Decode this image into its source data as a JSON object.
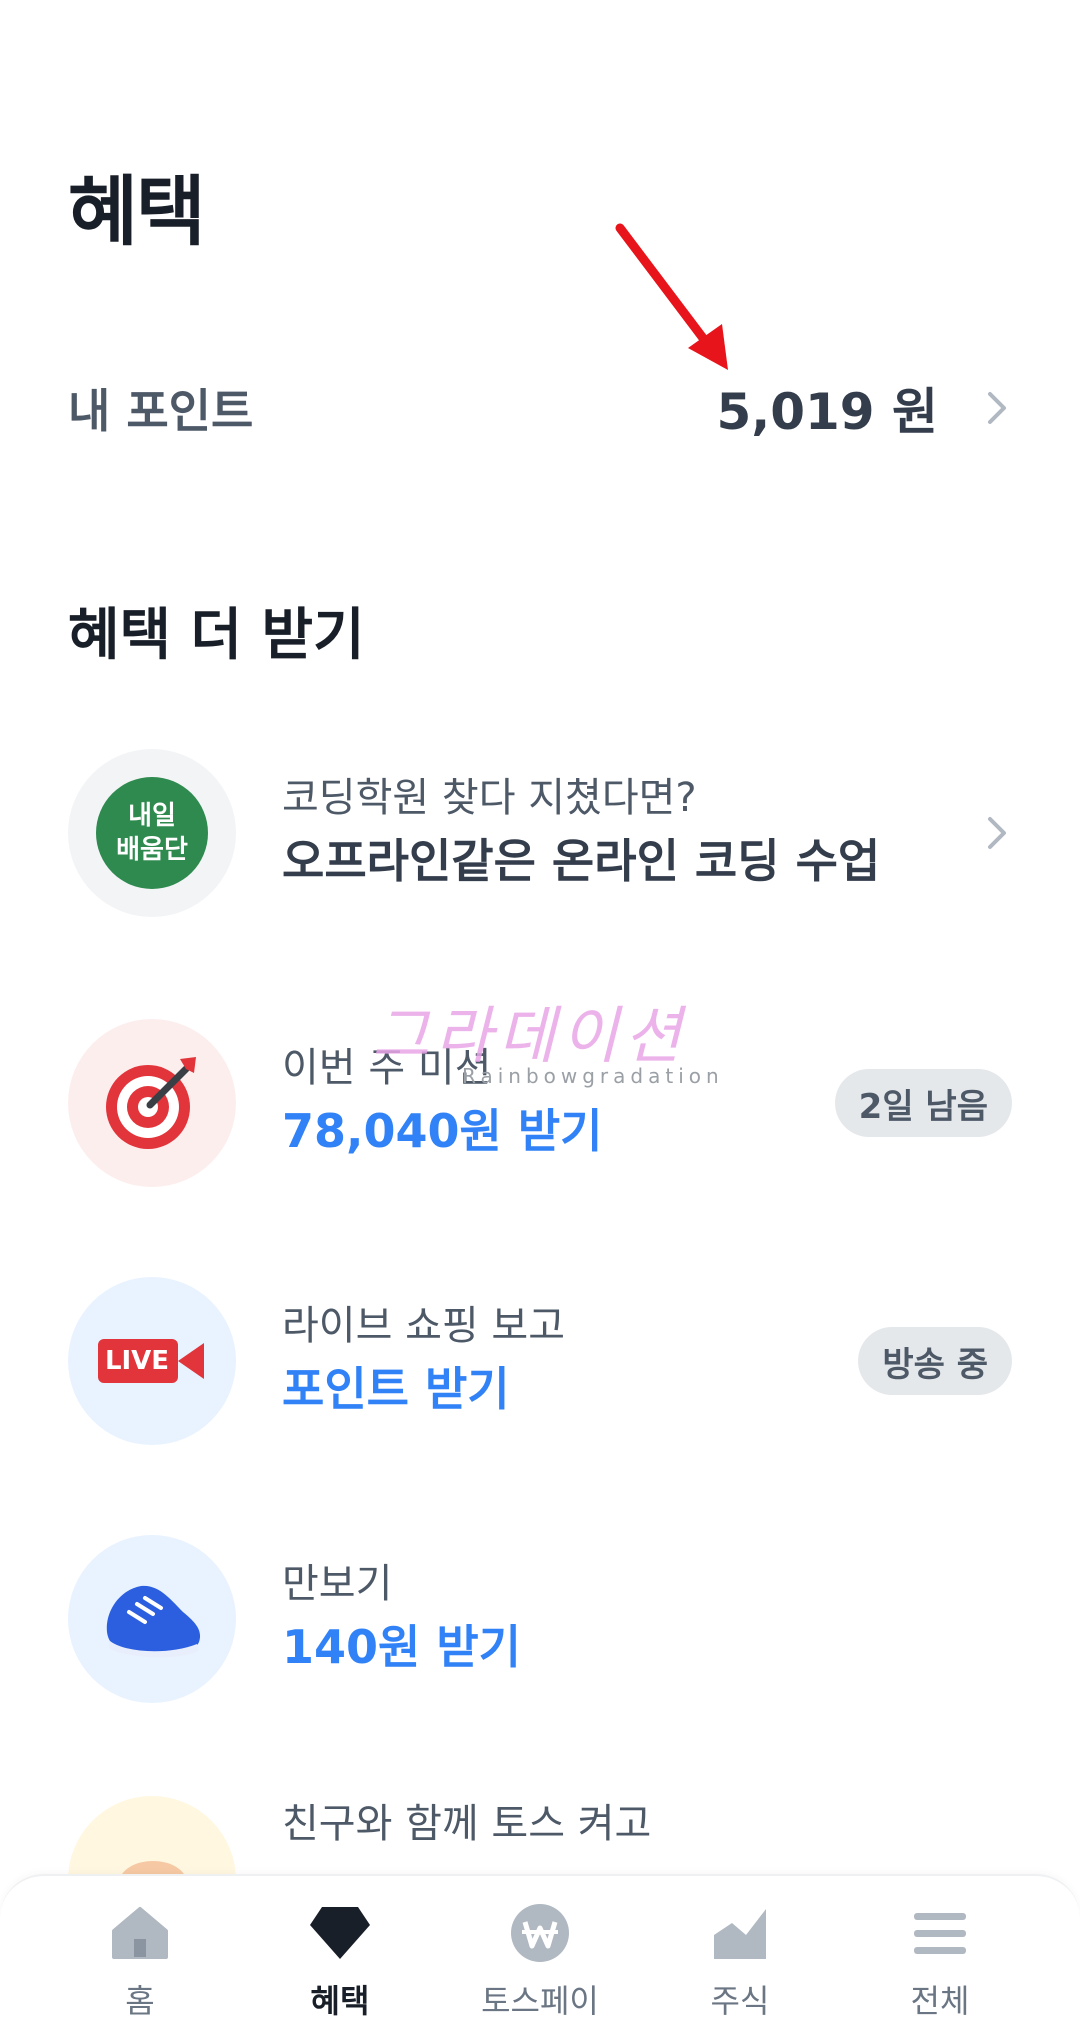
{
  "header": {
    "title": "혜택"
  },
  "points": {
    "label": "내 포인트",
    "value": "5,019 원"
  },
  "section": {
    "title": "혜택 더 받기"
  },
  "items": [
    {
      "sub": "코딩학원 찾다 지쳤다면?",
      "main": "오프라인같은 온라인 코딩 수업",
      "logo_line1": "내일",
      "logo_line2": "배움단"
    },
    {
      "sub": "이번 주 미션",
      "main": "78,040원 받기",
      "badge": "2일 남음"
    },
    {
      "sub": "라이브 쇼핑 보고",
      "main": "포인트 받기",
      "badge": "방송 중",
      "icon_text": "LIVE"
    },
    {
      "sub": "만보기",
      "main": "140원 받기"
    },
    {
      "sub": "친구와 함께 토스 켜고"
    }
  ],
  "watermark": {
    "text": "그라데이션",
    "sub": "Rainbowgradation"
  },
  "nav": [
    {
      "label": "홈",
      "icon": "home-icon"
    },
    {
      "label": "혜택",
      "icon": "gem-icon"
    },
    {
      "label": "토스페이",
      "icon": "won-icon"
    },
    {
      "label": "주식",
      "icon": "chart-icon"
    },
    {
      "label": "전체",
      "icon": "menu-icon"
    }
  ],
  "colors": {
    "accent": "#3182f6",
    "text": "#191f28",
    "arrow": "#e8141b"
  }
}
